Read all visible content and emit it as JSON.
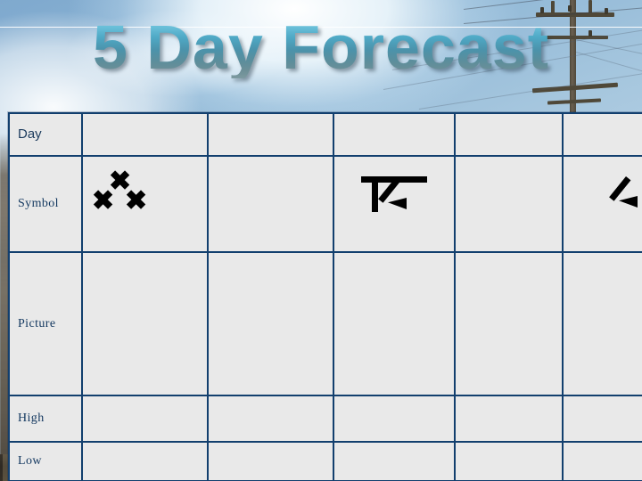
{
  "slide": {
    "title": "5 Day Forecast",
    "background_description": "sky-with-power-pole-photo",
    "accent_color": "#4fa9c6",
    "table_border_color": "#123f6e",
    "cell_background_color": "#e9e9e9",
    "label_text_color": "#12375f"
  },
  "table": {
    "column_count": 6,
    "row_labels": [
      "Day",
      "Symbol",
      "Picture",
      "High",
      "Low"
    ],
    "rows": [
      {
        "label": "Day",
        "cells": [
          "",
          "",
          "",
          "",
          ""
        ]
      },
      {
        "label": "Symbol",
        "cells": [
          "snow-symbol",
          "",
          "thunderstorm-symbol",
          "",
          "lightning-symbol"
        ]
      },
      {
        "label": "Picture",
        "cells": [
          "",
          "",
          "",
          "",
          ""
        ]
      },
      {
        "label": "High",
        "cells": [
          "",
          "",
          "",
          "",
          ""
        ]
      },
      {
        "label": "Low",
        "cells": [
          "",
          "",
          "",
          "",
          ""
        ]
      }
    ]
  }
}
